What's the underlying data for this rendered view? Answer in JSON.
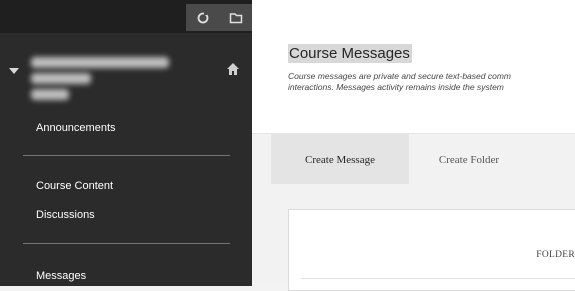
{
  "sidebar": {
    "toolbar_icons": [
      "refresh-icon",
      "folder-icon"
    ],
    "course_menu_icon": "home-icon",
    "items": [
      {
        "label": "Announcements"
      },
      {
        "label": "Course Content"
      },
      {
        "label": "Discussions"
      },
      {
        "label": "Messages"
      }
    ]
  },
  "main": {
    "title": "Course Messages",
    "description_lines": [
      "Course messages are private and secure text-based comm",
      "interactions. Messages activity remains inside the system"
    ],
    "tabs": [
      {
        "label": "Create Message",
        "active": true
      },
      {
        "label": "Create Folder",
        "active": false
      }
    ],
    "table": {
      "column_header": "FOLDER"
    }
  },
  "colors": {
    "sidebar_bg": "#2b2b2b",
    "topbar_bg": "#1f1f1f",
    "main_bg": "#ffffff",
    "tabbar_bg": "#f2f2f2"
  }
}
